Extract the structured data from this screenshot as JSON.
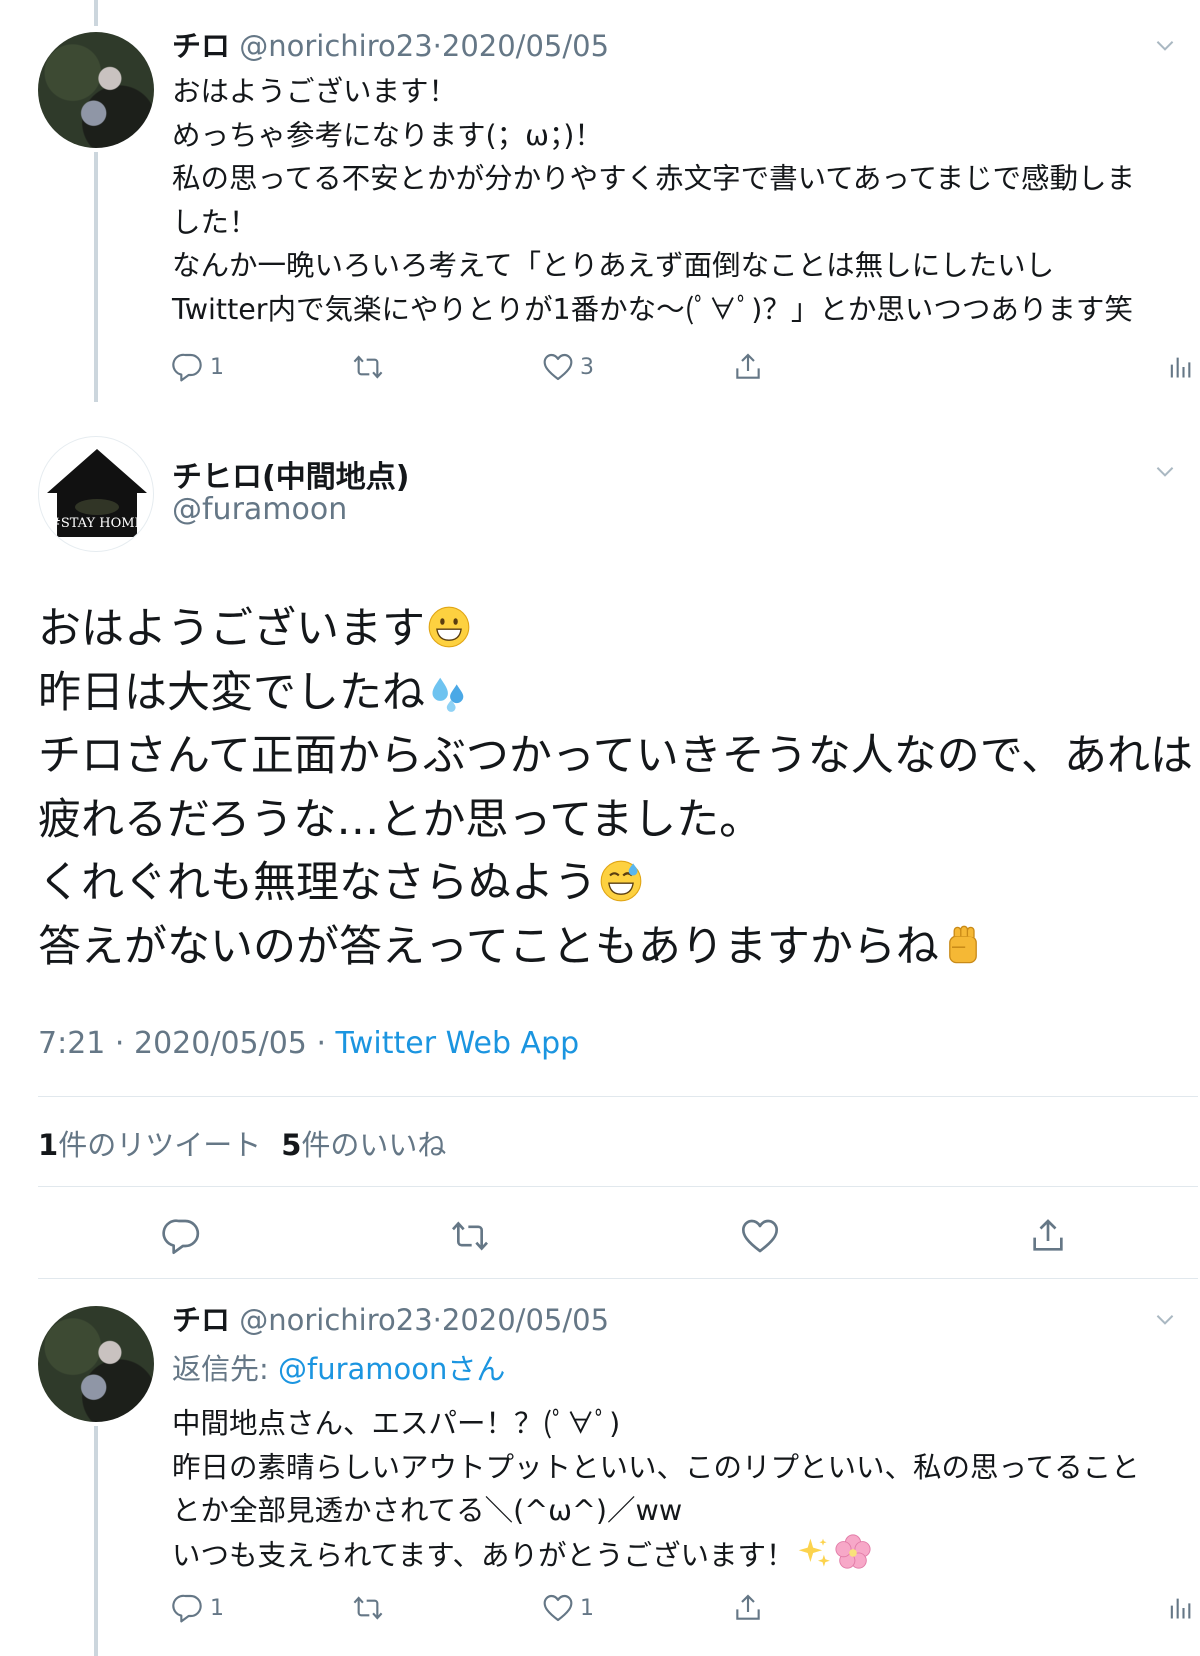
{
  "tweet1": {
    "name": "チロ",
    "handle": "@norichiro23",
    "date": "2020/05/05",
    "lines": [
      "おはようございます！",
      "めっちゃ参考になります(；ω；)！",
      "私の思ってる不安とかが分かりやすく赤文字で書いてあってまじで感動しま",
      "した！",
      "なんか一晩いろいろ考えて「とりあえず面倒なことは無しにしたいし",
      "Twitter内で気楽にやりとりが1番かな〜(ﾟ∀ﾟ)？」とか思いつつあります笑"
    ],
    "reply_count": "1",
    "like_count": "3"
  },
  "main_tweet": {
    "name": "チヒロ(中間地点)",
    "handle": "@furamoon",
    "avatar_text": "#STAY HOME",
    "lines": [
      "おはようございます",
      "昨日は大変でしたね",
      "チロさんて正面からぶつかっていきそうな人なので、あれは",
      "疲れるだろうな…とか思ってました。",
      "くれぐれも無理なさらぬよう",
      "答えがないのが答えってこともありますからね"
    ],
    "emoji": [
      "grinning-face",
      "sweat-droplets",
      "",
      "",
      "grinning-sweat-face",
      "raised-fist"
    ],
    "time": "7:21",
    "date": "2020/05/05",
    "source": "Twitter Web App",
    "retweet_count": "1",
    "retweet_label": "件のリツイート",
    "like_count": "5",
    "like_label": "件のいいね"
  },
  "tweet3": {
    "name": "チロ",
    "handle": "@norichiro23",
    "date": "2020/05/05",
    "reply_prefix": "返信先: ",
    "reply_mention": "@furamoonさん",
    "lines": [
      "中間地点さん、エスパー！？(ﾟ∀ﾟ)",
      "昨日の素晴らしいアウトプットといい、このリプといい、私の思ってること",
      "とか全部見透かされてる＼(^ω^)／ww",
      "いつも支えられてます、ありがとうございます！"
    ],
    "emoji": [
      "sparkles",
      "cherry-blossom"
    ],
    "reply_count": "1",
    "like_count": "1"
  },
  "icons": [
    "reply-icon",
    "retweet-icon",
    "like-icon",
    "share-icon",
    "analytics-icon",
    "chevron-down-icon"
  ],
  "colors": {
    "link": "#1b95e0",
    "muted": "#657786",
    "text": "#14171a",
    "divider": "#e1e8ed",
    "thread_line": "#ccd6dd"
  }
}
